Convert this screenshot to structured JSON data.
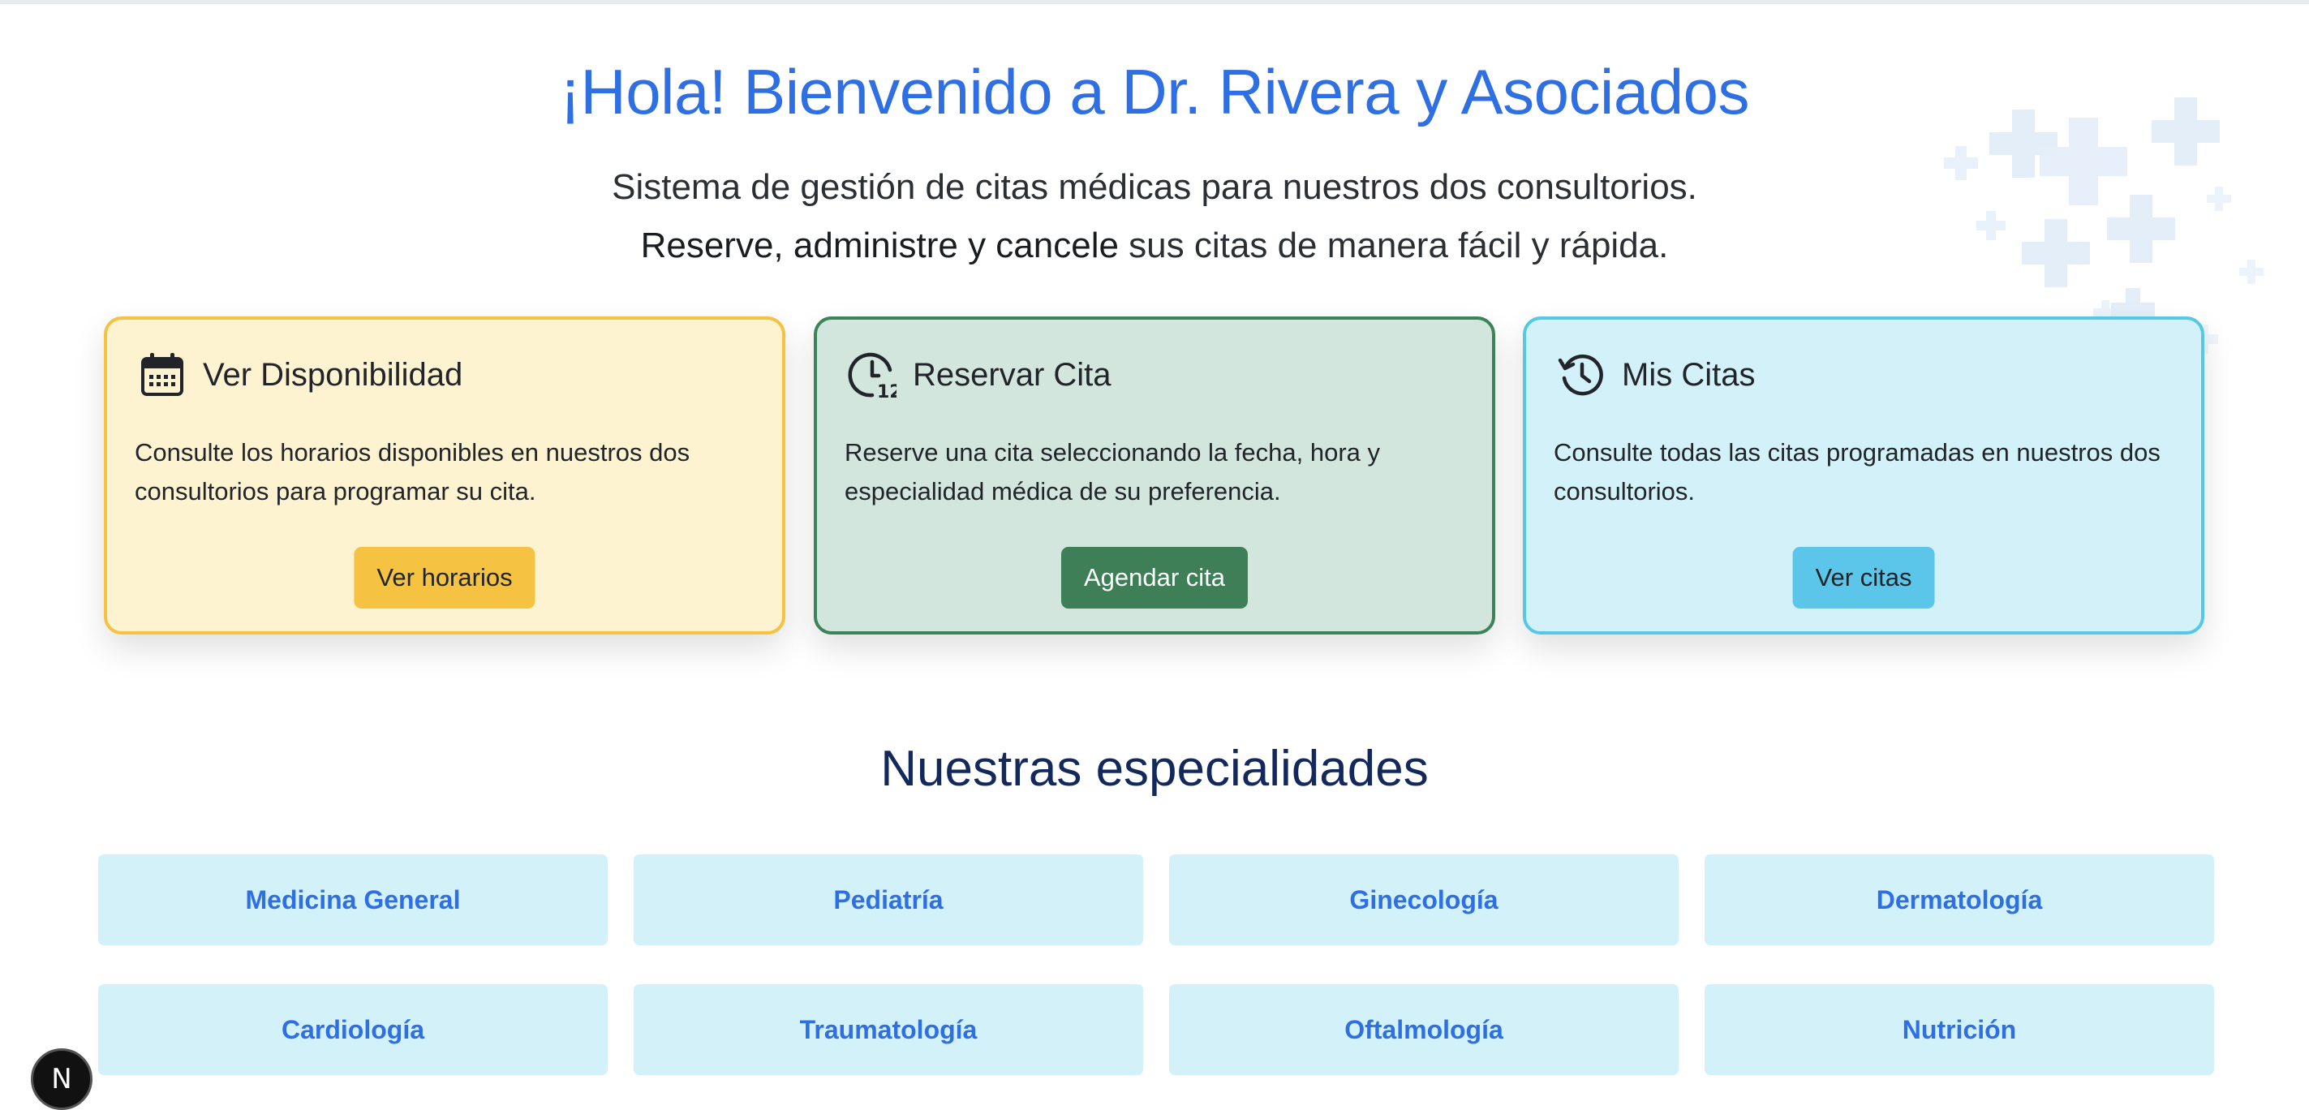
{
  "hero": {
    "title": "¡Hola! Bienvenido a Dr. Rivera y Asociados",
    "subtitle_line1": "Sistema de gestión de citas médicas para nuestros dos consultorios.",
    "subtitle_line2_strong": "Reserve, administre y cancele",
    "subtitle_line2_rest": " sus citas de manera fácil y rápida."
  },
  "cards": [
    {
      "icon": "calendar-icon",
      "title": "Ver Disponibilidad",
      "text": "Consulte los horarios disponibles en nuestros dos consultorios para programar su cita.",
      "button": "Ver horarios"
    },
    {
      "icon": "clock-icon",
      "title": "Reservar Cita",
      "text": "Reserve una cita seleccionando la fecha, hora y especialidad médica de su preferencia.",
      "button": "Agendar cita"
    },
    {
      "icon": "history-icon",
      "title": "Mis Citas",
      "text": "Consulte todas las citas programadas en nuestros dos consultorios.",
      "button": "Ver citas"
    }
  ],
  "specialties": {
    "title": "Nuestras especialidades",
    "items": [
      "Medicina General",
      "Pediatría",
      "Ginecología",
      "Dermatología",
      "Cardiología",
      "Traumatología",
      "Oftalmología",
      "Nutrición"
    ]
  },
  "badge": {
    "letter": "N"
  },
  "colors": {
    "accent": "#2f6fe4",
    "section_title": "#13285b",
    "yellow": "#f5c242",
    "green": "#3e7f57",
    "cyan": "#5bc6ea"
  }
}
